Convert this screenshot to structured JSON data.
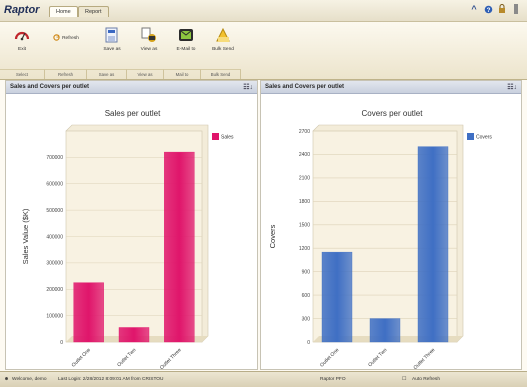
{
  "app": {
    "logo": "Raptor"
  },
  "tabs": [
    {
      "label": "Home"
    },
    {
      "label": "Report"
    }
  ],
  "ribbon": {
    "buttons": [
      {
        "label": "Exit",
        "icon": "gauge-icon"
      },
      {
        "label": "Refresh",
        "icon": "refresh-icon"
      },
      {
        "label": "Save as",
        "icon": "save-icon"
      },
      {
        "label": "View as",
        "icon": "view-icon"
      },
      {
        "label": "E-Mail to",
        "icon": "email-icon"
      },
      {
        "label": "Bulk Send",
        "icon": "bulk-send-icon"
      }
    ],
    "groups": [
      "Select",
      "Refresh",
      "Save as",
      "View as",
      "Mail to",
      "Bulk Send"
    ]
  },
  "panels": [
    {
      "header": "Sales and Covers per outlet"
    },
    {
      "header": "Sales and Covers per outlet"
    }
  ],
  "colors": {
    "sales": "#e0156b",
    "covers": "#3f6fc4",
    "panel_header": "#c9d0de"
  },
  "chart_data": [
    {
      "type": "bar",
      "title": "Sales per outlet",
      "categories": [
        "Outlet One",
        "Outlet Two",
        "Outlet Three"
      ],
      "series": [
        {
          "name": "Sales",
          "values": [
            225000,
            55000,
            720000
          ]
        }
      ],
      "xlabel": "Outlets",
      "ylabel": "Sales Value ($K)",
      "ylim": [
        0,
        800000
      ],
      "yticks": [
        "0",
        "100000",
        "200000",
        "300000",
        "400000",
        "500000",
        "600000",
        "700000"
      ],
      "grid": true,
      "legend": "top-right"
    },
    {
      "type": "bar",
      "title": "Covers per outlet",
      "categories": [
        "Outlet One",
        "Outlet Two",
        "Outlet Three"
      ],
      "series": [
        {
          "name": "Covers",
          "values": [
            1150,
            300,
            2500
          ]
        }
      ],
      "xlabel": "Outlets",
      "ylabel": "Covers",
      "ylim": [
        0,
        2700
      ],
      "yticks": [
        "0",
        "300",
        "600",
        "900",
        "1200",
        "1500",
        "1800",
        "2100",
        "2400",
        "2700"
      ],
      "grid": true,
      "legend": "top-right"
    }
  ],
  "status": {
    "welcome": "Welcome, demo",
    "last_login": "Last Login: 2/28/2012 8:09:01 AM from CRISTOU",
    "product": "Raptor PFO",
    "auto_refresh": "Auto Refresh"
  }
}
